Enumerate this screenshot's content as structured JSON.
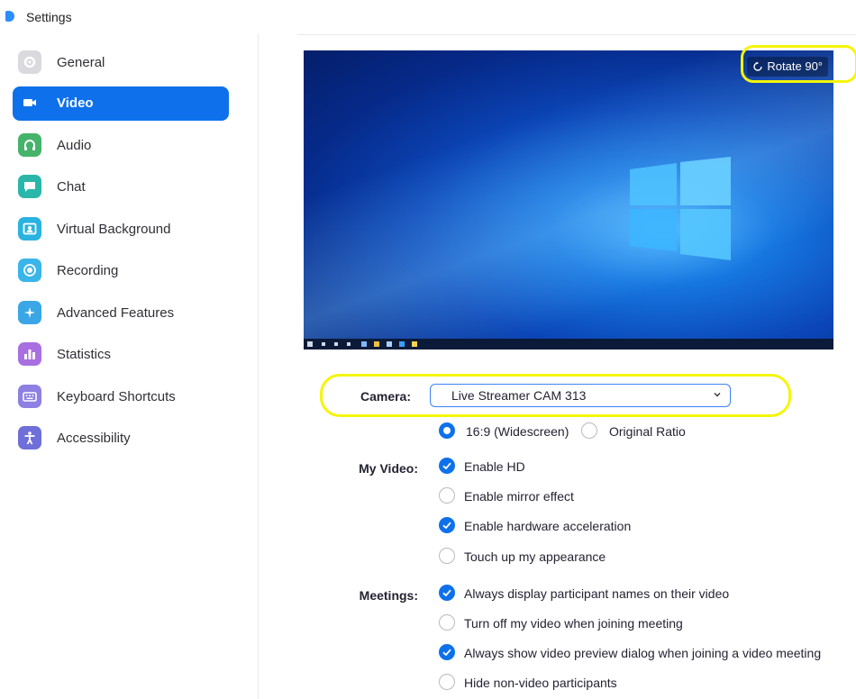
{
  "window": {
    "title": "Settings"
  },
  "sidebar": {
    "items": [
      {
        "label": "General",
        "icon": "gear-icon",
        "color": "#d9d9de"
      },
      {
        "label": "Video",
        "icon": "video-camera-icon",
        "color": "#0e71eb",
        "active": true
      },
      {
        "label": "Audio",
        "icon": "headphones-icon",
        "color": "#46b36b"
      },
      {
        "label": "Chat",
        "icon": "chat-bubble-icon",
        "color": "#2ab7a9"
      },
      {
        "label": "Virtual Background",
        "icon": "person-frame-icon",
        "color": "#2ab3e0"
      },
      {
        "label": "Recording",
        "icon": "record-icon",
        "color": "#39b5ea"
      },
      {
        "label": "Advanced Features",
        "icon": "sparkle-icon",
        "color": "#3aa6e6"
      },
      {
        "label": "Statistics",
        "icon": "bar-chart-icon",
        "color": "#a86fe0"
      },
      {
        "label": "Keyboard Shortcuts",
        "icon": "keyboard-icon",
        "color": "#8d7fe3"
      },
      {
        "label": "Accessibility",
        "icon": "accessibility-icon",
        "color": "#6f6fd9"
      }
    ]
  },
  "preview": {
    "rotate_label": "Rotate 90°"
  },
  "camera": {
    "label": "Camera:",
    "selected": "Live Streamer CAM 313"
  },
  "ratio": {
    "option1": "16:9 (Widescreen)",
    "option2": "Original Ratio",
    "selected": "16:9 (Widescreen)"
  },
  "my_video": {
    "label": "My Video:",
    "options": [
      {
        "label": "Enable HD",
        "checked": true
      },
      {
        "label": "Enable mirror effect",
        "checked": false
      },
      {
        "label": "Enable hardware acceleration",
        "checked": true
      },
      {
        "label": "Touch up my appearance",
        "checked": false
      }
    ]
  },
  "meetings": {
    "label": "Meetings:",
    "options": [
      {
        "label": "Always display participant names on their video",
        "checked": true
      },
      {
        "label": "Turn off my video when joining meeting",
        "checked": false
      },
      {
        "label": "Always show video preview dialog when joining a video meeting",
        "checked": true
      },
      {
        "label": "Hide non-video participants",
        "checked": false
      }
    ]
  },
  "colors": {
    "accent": "#0e71eb",
    "highlight": "#f5f50a"
  }
}
